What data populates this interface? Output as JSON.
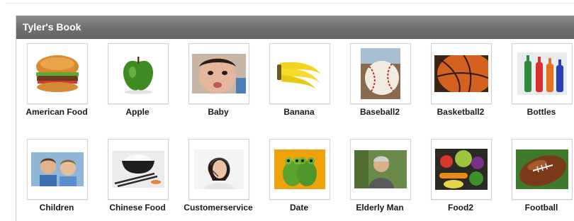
{
  "book": {
    "title": "Tyler's Book",
    "rows": [
      [
        {
          "label": "American Food",
          "icon": "hamburger-icon"
        },
        {
          "label": "Apple",
          "icon": "apple-icon"
        },
        {
          "label": "Baby",
          "icon": "baby-icon"
        },
        {
          "label": "Banana",
          "icon": "banana-icon"
        },
        {
          "label": "Baseball2",
          "icon": "baseball-icon"
        },
        {
          "label": "Basketball2",
          "icon": "basketball-icon"
        },
        {
          "label": "Bottles",
          "icon": "bottles-icon"
        }
      ],
      [
        {
          "label": "Children",
          "icon": "children-icon"
        },
        {
          "label": "Chinese Food",
          "icon": "rice-bowl-icon"
        },
        {
          "label": "Customerservice",
          "icon": "headset-agent-icon"
        },
        {
          "label": "Date",
          "icon": "frogs-icon"
        },
        {
          "label": "Elderly Man",
          "icon": "elderly-man-icon"
        },
        {
          "label": "Food2",
          "icon": "vegetables-icon"
        },
        {
          "label": "Football",
          "icon": "football-icon"
        }
      ]
    ]
  }
}
